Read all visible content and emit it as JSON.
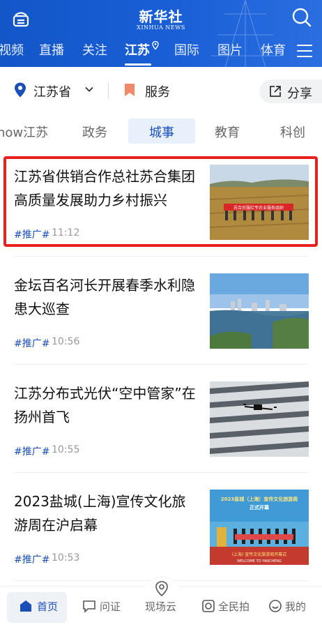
{
  "header": {
    "brand_cn": "新华社",
    "brand_en": "XINHUA NEWS",
    "channels": [
      "视频",
      "直播",
      "关注",
      "江苏",
      "国际",
      "图片",
      "体育"
    ],
    "active_channel": "江苏"
  },
  "location": {
    "province": "江苏省",
    "service": "服务",
    "share": "分享"
  },
  "subtabs": [
    "how江苏",
    "政务",
    "城事",
    "教育",
    "科创"
  ],
  "active_subtab": "城事",
  "articles": [
    {
      "title": "江苏省供销合作总社苏合集团高质量发展助力乡村振兴",
      "tag": "#推广#",
      "time": "11:12",
      "banner": "苏合农服红专农业服务组织"
    },
    {
      "title": "金坛百名河长开展春季水利隐患大巡查",
      "tag": "#推广#",
      "time": "10:56"
    },
    {
      "title": "江苏分布式光伏“空中管家”在扬州首飞",
      "tag": "#推广#",
      "time": "10:55"
    },
    {
      "title": "2023盐城(上海)宣传文化旅游周在沪启幕",
      "tag": "#推广#",
      "time": "10:53",
      "banner_top": "2023盐城（上海）宣传文化旅游周",
      "banner_sub": "正式开幕",
      "banner_bottom": "(上海) 宣传文化旅游周开幕式",
      "banner_en": "WELCOME TO YANCHENG"
    }
  ],
  "bottom_nav": {
    "home": "首页",
    "ask": "问证",
    "live": "现场云",
    "photo": "全民拍",
    "mine": "我的"
  },
  "colors": {
    "brand_blue": "#1a5fd6",
    "accent": "#1a4fb8",
    "highlight": "#e8201e"
  }
}
